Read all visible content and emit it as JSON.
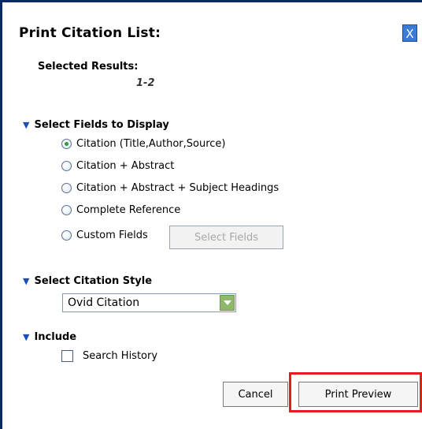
{
  "dialog": {
    "title": "Print Citation List:",
    "close_label": "X"
  },
  "selected_results": {
    "label": "Selected Results:",
    "value": "1-2"
  },
  "fields_section": {
    "heading": "Select Fields to Display",
    "options": [
      {
        "label": "Citation (Title,Author,Source)",
        "checked": true
      },
      {
        "label": "Citation + Abstract",
        "checked": false
      },
      {
        "label": "Citation + Abstract + Subject Headings",
        "checked": false
      },
      {
        "label": "Complete Reference",
        "checked": false
      },
      {
        "label": "Custom Fields",
        "checked": false
      }
    ],
    "select_fields_button": "Select Fields"
  },
  "citation_style": {
    "heading": "Select Citation Style",
    "selected": "Ovid Citation"
  },
  "include_section": {
    "heading": "Include",
    "search_history_label": "Search History",
    "search_history_checked": false
  },
  "buttons": {
    "cancel": "Cancel",
    "print_preview": "Print Preview"
  },
  "colors": {
    "accent": "#1a4fb8",
    "radio_checked": "#2d9d3a",
    "highlight": "#e0201f"
  }
}
